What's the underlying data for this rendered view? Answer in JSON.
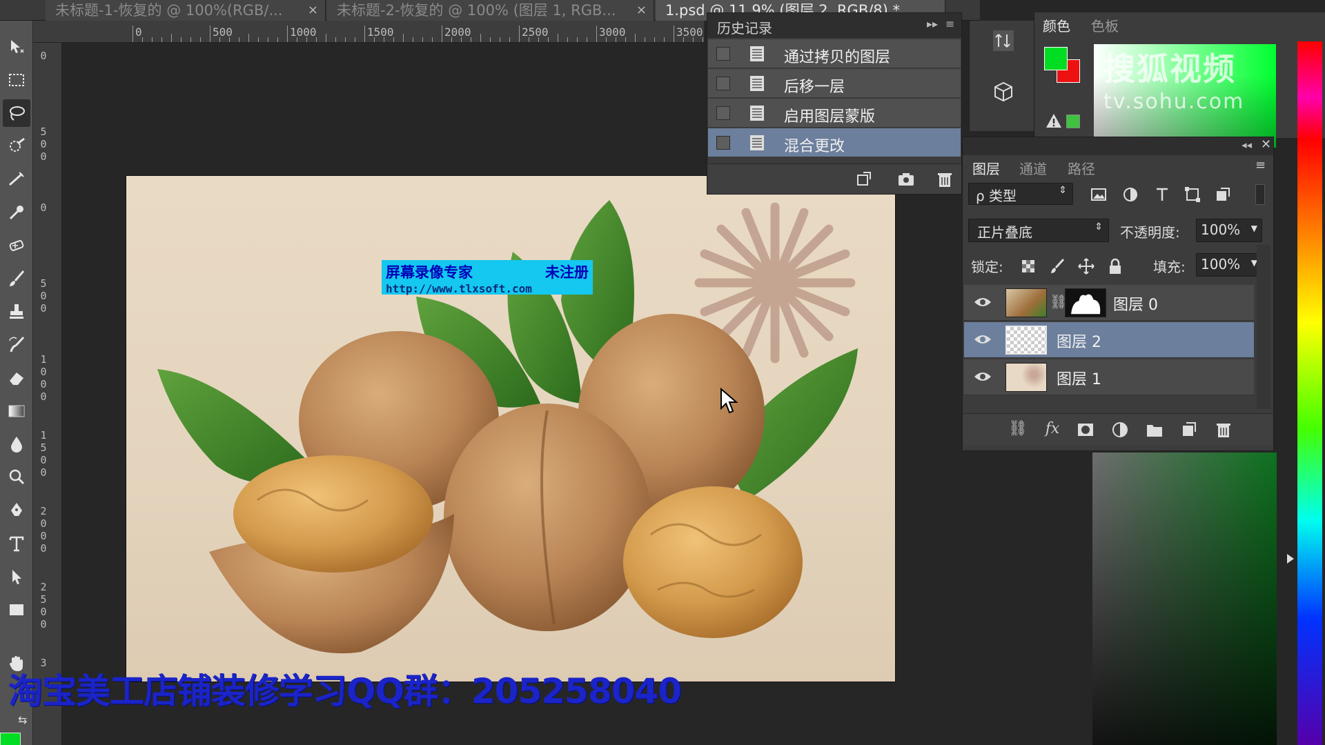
{
  "tabs": [
    {
      "label": "未标题-1-恢复的 @ 100%(RGB/...",
      "close": "×",
      "active": false
    },
    {
      "label": "未标题-2-恢复的 @ 100% (图层 1, RGB...",
      "close": "×",
      "active": false
    },
    {
      "label": "1.psd @ 11.9% (图层 2, RGB/8) *",
      "close": "×",
      "active": true
    }
  ],
  "ruler": {
    "h_labels": [
      "0",
      "500",
      "1000",
      "1500",
      "2000",
      "2500",
      "3000",
      "3500"
    ],
    "v_labels": [
      "0",
      "500",
      "0",
      "500",
      "1000",
      "1500",
      "2000",
      "2500",
      "3"
    ]
  },
  "canvas": {
    "watermark_line1_left": "屏幕录像专家",
    "watermark_line1_right": "未注册",
    "watermark_line2": "http://www.tlxsoft.com"
  },
  "overlay_text": "淘宝美工店铺装修学习QQ群：205258040",
  "history": {
    "title": "历史记录",
    "items": [
      {
        "label": "通过拷贝的图层",
        "selected": false
      },
      {
        "label": "后移一层",
        "selected": false
      },
      {
        "label": "启用图层蒙版",
        "selected": false
      },
      {
        "label": "混合更改",
        "selected": true
      }
    ]
  },
  "color_panel": {
    "tabs": [
      "颜色",
      "色板"
    ],
    "foreground": "#00dd22",
    "background": "#ee1111",
    "watermark_line1": "搜狐视频",
    "watermark_line2": "tv.sohu.com"
  },
  "layers_panel": {
    "tabs": [
      "图层",
      "通道",
      "路径"
    ],
    "filter_label": "ρ 类型",
    "blend_mode": "正片叠底",
    "opacity_label": "不透明度:",
    "opacity_value": "100%",
    "lock_label": "锁定:",
    "fill_label": "填充:",
    "fill_value": "100%",
    "layers": [
      {
        "name": "图层 0",
        "visible": true,
        "has_mask": true,
        "selected": false
      },
      {
        "name": "图层 2",
        "visible": true,
        "has_mask": false,
        "selected": true
      },
      {
        "name": "图层 1",
        "visible": true,
        "has_mask": false,
        "selected": false
      }
    ]
  },
  "icons": [
    "move-icon",
    "marquee-icon",
    "lasso-icon",
    "quick-select-icon",
    "crop-icon",
    "eyedropper-icon",
    "heal-icon",
    "brush-icon",
    "stamp-icon",
    "history-brush-icon",
    "eraser-icon",
    "gradient-icon",
    "blur-icon",
    "dodge-icon",
    "pen-icon",
    "type-icon",
    "path-select-icon",
    "shape-icon",
    "hand-icon"
  ]
}
